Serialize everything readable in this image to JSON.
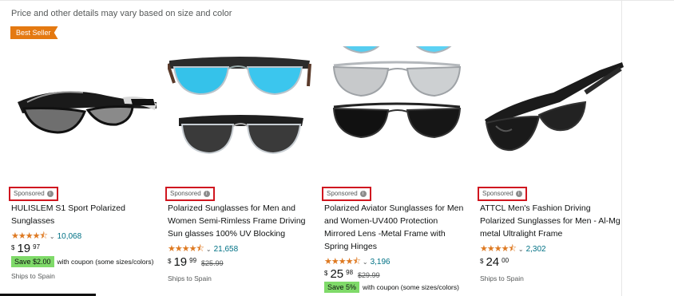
{
  "notice": "Price and other details may vary based on size and color",
  "badge": "Best Seller",
  "products": [
    {
      "sponsored": "Sponsored",
      "title": "HULISLEM S1 Sport Polarized Sunglasses",
      "stars": "★★★★⯪",
      "reviews": "10,068",
      "price": {
        "symbol": "$",
        "whole": "19",
        "fraction": "97",
        "list": ""
      },
      "coupon": {
        "chip": "Save $2.00",
        "text": "with coupon (some sizes/colors)"
      },
      "shipping": "Ships to Spain"
    },
    {
      "sponsored": "Sponsored",
      "title": "Polarized Sunglasses for Men and Women Semi-Rimless Frame Driving Sun glasses 100% UV Blocking",
      "stars": "★★★★⯪",
      "reviews": "21,658",
      "price": {
        "symbol": "$",
        "whole": "19",
        "fraction": "99",
        "list": "$25.99"
      },
      "coupon": null,
      "shipping": "Ships to Spain"
    },
    {
      "sponsored": "Sponsored",
      "title": "Polarized Aviator Sunglasses for Men and Women-UV400 Protection Mirrored Lens -Metal Frame with Spring Hinges",
      "stars": "★★★★⯪",
      "reviews": "3,196",
      "price": {
        "symbol": "$",
        "whole": "25",
        "fraction": "98",
        "list": "$29.99"
      },
      "coupon": {
        "chip": "Save 5%",
        "text": "with coupon (some sizes/colors)"
      },
      "shipping": ""
    },
    {
      "sponsored": "Sponsored",
      "title": "ATTCL Men's Fashion Driving Polarized Sunglasses for Men - Al-Mg metal Ultralight Frame",
      "stars": "★★★★⯪",
      "reviews": "2,302",
      "price": {
        "symbol": "$",
        "whole": "24",
        "fraction": "00",
        "list": ""
      },
      "coupon": null,
      "shipping": "Ships to Spain"
    }
  ],
  "colors": {
    "star": "#de7921",
    "badge": "#e47911",
    "link": "#007185",
    "coupon": "#7fda69",
    "sponsored_box": "#d0161f"
  }
}
